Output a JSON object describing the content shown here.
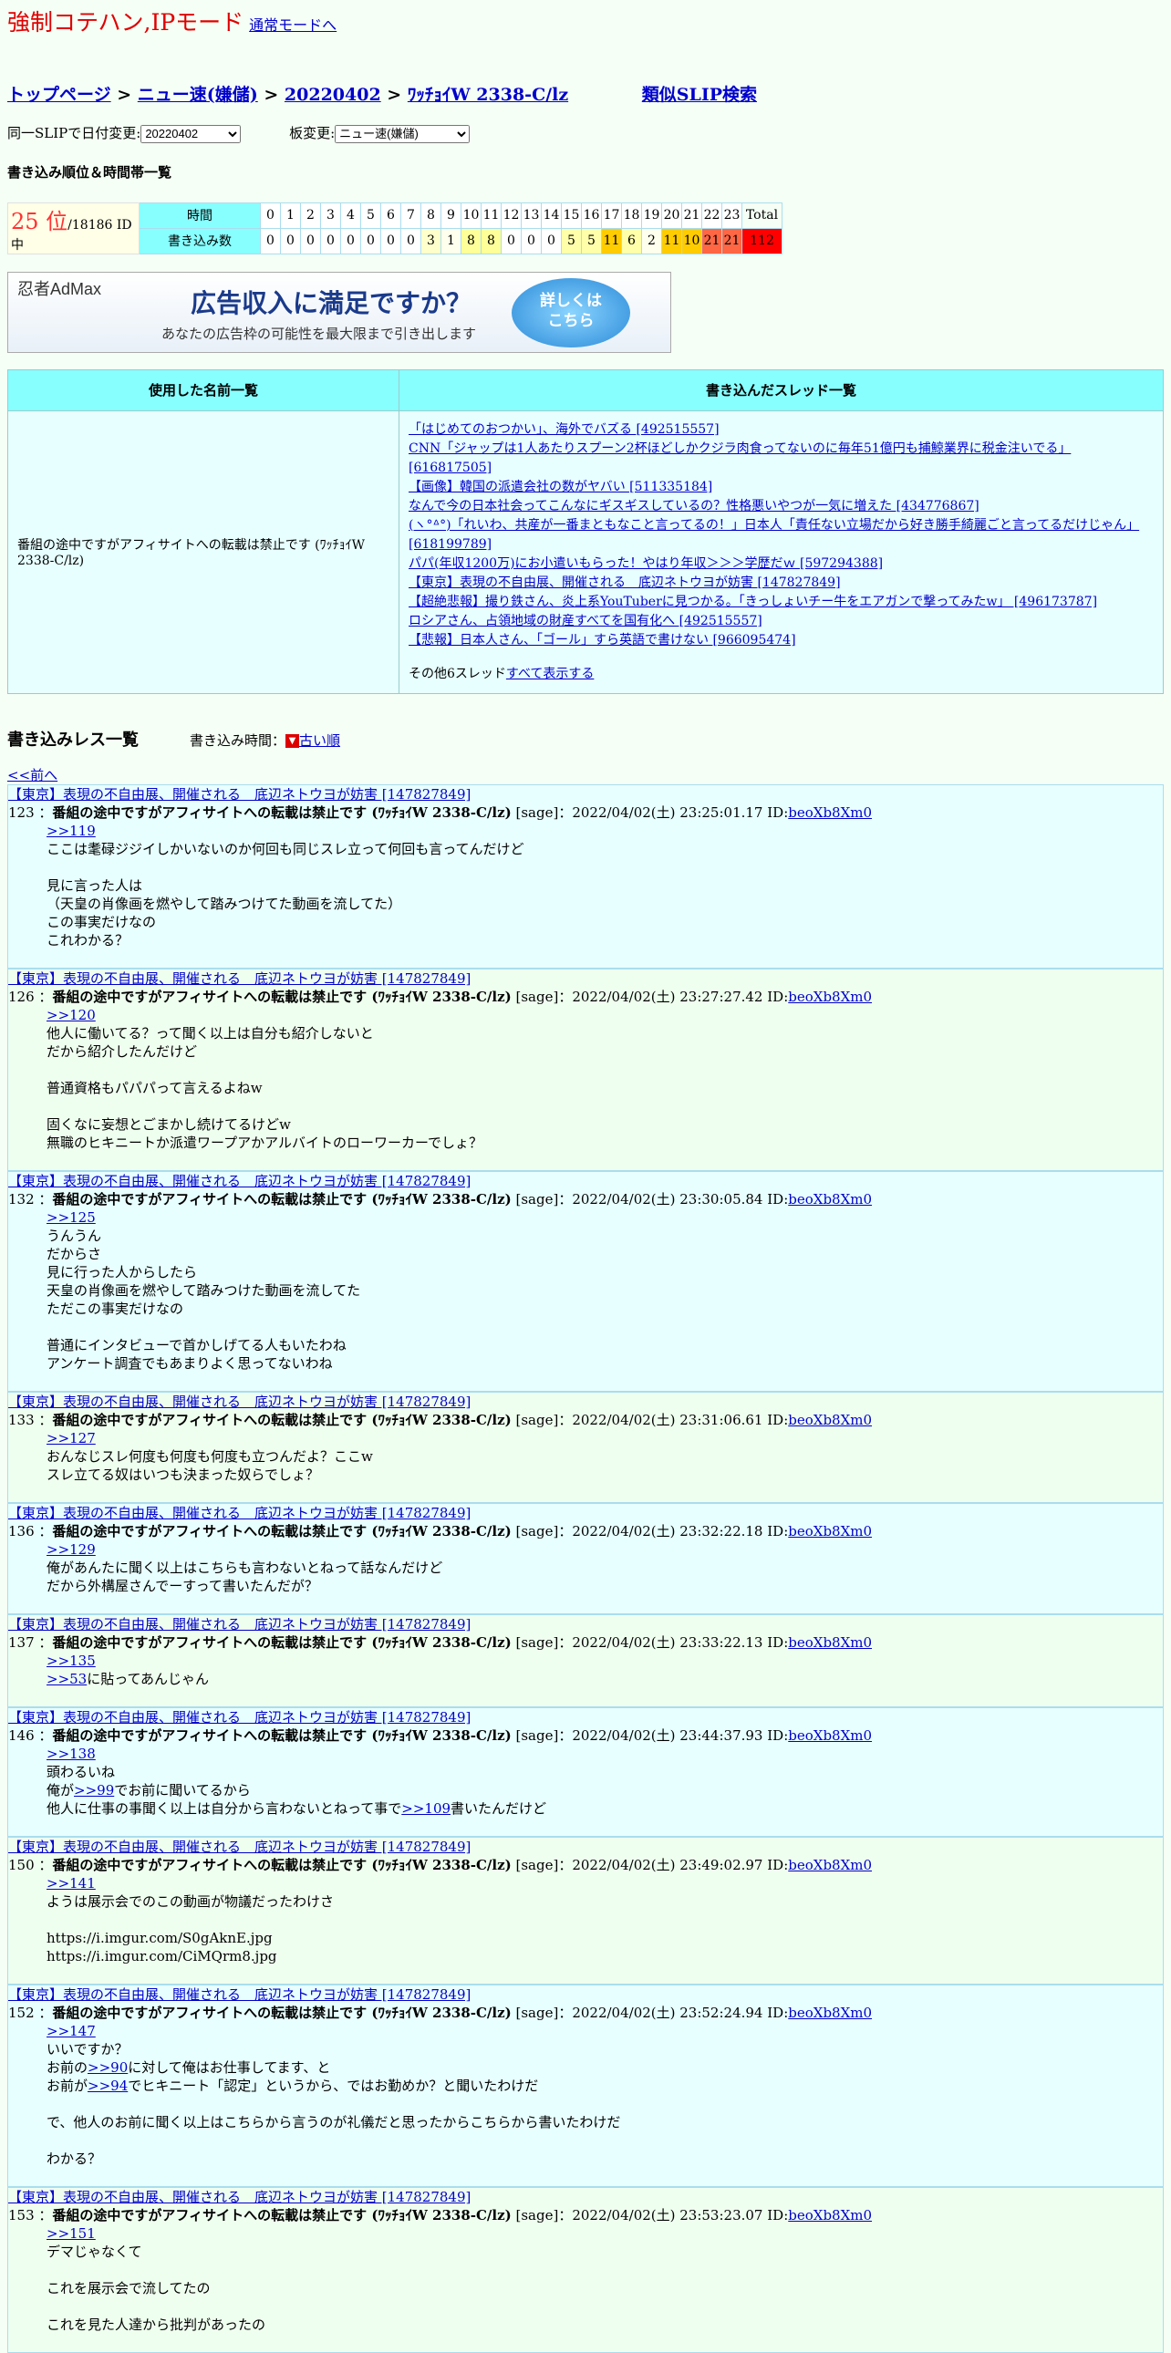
{
  "header": {
    "title": "強制コテハン,IPモード",
    "normal_link": "通常モードへ"
  },
  "breadcrumb": {
    "top": "トップページ",
    "board": "ニュー速(嫌儲)",
    "date": "20220402",
    "slip": "ﾜｯﾁｮｲW 2338-C/lz",
    "similar": "類似SLIP検索"
  },
  "selectors": {
    "date_label": "同一SLIPで日付変更:",
    "date_value": "20220402",
    "board_label": "板変更:",
    "board_value": "ニュー速(嫌儲)"
  },
  "rank_section": {
    "heading": "書き込み順位＆時間帯一覧",
    "rank": "25 位",
    "rank_suffix": "/18186 ID中",
    "time_label": "時間",
    "count_label": "書き込み数",
    "hours": [
      "0",
      "1",
      "2",
      "3",
      "4",
      "5",
      "6",
      "7",
      "8",
      "9",
      "10",
      "11",
      "12",
      "13",
      "14",
      "15",
      "16",
      "17",
      "18",
      "19",
      "20",
      "21",
      "22",
      "23",
      "Total"
    ],
    "counts": [
      "0",
      "0",
      "0",
      "0",
      "0",
      "0",
      "0",
      "0",
      "3",
      "1",
      "8",
      "8",
      "0",
      "0",
      "0",
      "5",
      "5",
      "11",
      "6",
      "2",
      "11",
      "10",
      "21",
      "21",
      "112"
    ],
    "count_colors": [
      "#ffffff",
      "#ffffff",
      "#ffffff",
      "#ffffff",
      "#ffffff",
      "#ffffff",
      "#ffffff",
      "#ffffff",
      "#ffffcc",
      "#ffffee",
      "#ffff99",
      "#ffff99",
      "#ffffff",
      "#ffffff",
      "#ffffff",
      "#ffffaa",
      "#ffffaa",
      "#ffcc00",
      "#ffffaa",
      "#ffffee",
      "#ffcc00",
      "#ffcc00",
      "#ff6644",
      "#ff6644",
      "#ff0000"
    ]
  },
  "ad": {
    "logo": "忍者AdMax",
    "headline": "広告収入に満足ですか？",
    "sub": "あなたの広告枠の可能性を最大限まで引き出します",
    "button_line1": "詳しくは",
    "button_line2": "こちら"
  },
  "names_table": {
    "col1": "使用した名前一覧",
    "col2": "書き込んだスレッド一覧",
    "name": "番組の途中ですがアフィサイトへの転載は禁止です (ﾜｯﾁｮｲW 2338-C/lz)",
    "threads": [
      "「はじめてのおつかい」、海外でバズる [492515557]",
      "CNN「ジャップは1人あたりスプーン2杯ほどしかクジラ肉食ってないのに毎年51億円も捕鯨業界に税金注いでる」 [616817505]",
      "【画像】韓国の派遣会社の数がヤバい [511335184]",
      "なんで今の日本社会ってこんなにギスギスしているの？性格悪いやつが一気に増えた [434776867]",
      "(ヽ°ᐞ°)「れいわ、共産が一番まともなこと言ってるの！」日本人「責任ない立場だから好き勝手綺麗ごと言ってるだけじゃん」 [618199789]",
      "パパ(年収1200万)にお小遣いもらった！やはり年収＞＞＞学歴だｗ [597294388]",
      "【東京】表現の不自由展、開催される　底辺ネトウヨが妨害 [147827849]",
      "【超絶悲報】撮り鉄さん、炎上系YouTuberに見つかる。「きっしょいチー牛をエアガンで撃ってみたw」 [496173787]",
      "ロシアさん、占領地域の財産すべてを国有化へ [492515557]",
      "【悲報】日本人さん、「ゴール」すら英語で書けない [966095474]"
    ],
    "more_text": "その他6スレッド",
    "more_link": "すべて表示する"
  },
  "responses": {
    "heading": "書き込みレス一覧",
    "order_label": "書き込み時間：",
    "order_link": "古い順",
    "prev_link": "<<前へ"
  },
  "posts": [
    {
      "thread": "【東京】表現の不自由展、開催される　底辺ネトウヨが妨害 [147827849]",
      "num": "123",
      "name": "番組の途中ですがアフィサイトへの転載は禁止です (ﾜｯﾁｮｲW 2338-C/lz)",
      "meta": "[sage]：2022/04/02(土) 23:25:01.17 ID:",
      "id": "beoXb8Xm0",
      "body": ">>119\nここは耄碌ジジイしかいないのか何回も同じスレ立って何回も言ってんだけど\n\n見に言った人は\n（天皇の肖像画を燃やして踏みつけてた動画を流してた）\nこの事実だけなの\nこれわかる？"
    },
    {
      "thread": "【東京】表現の不自由展、開催される　底辺ネトウヨが妨害 [147827849]",
      "num": "126",
      "name": "番組の途中ですがアフィサイトへの転載は禁止です (ﾜｯﾁｮｲW 2338-C/lz)",
      "meta": "[sage]：2022/04/02(土) 23:27:27.42 ID:",
      "id": "beoXb8Xm0",
      "body": ">>120\n他人に働いてる？って聞く以上は自分も紹介しないと\nだから紹介したんだけど\n\n普通資格もパパパって言えるよねw\n\n固くなに妄想とごまかし続けてるけどw\n無職のヒキニートか派遣ワープアかアルバイトのローワーカーでしょ？"
    },
    {
      "thread": "【東京】表現の不自由展、開催される　底辺ネトウヨが妨害 [147827849]",
      "num": "132",
      "name": "番組の途中ですがアフィサイトへの転載は禁止です (ﾜｯﾁｮｲW 2338-C/lz)",
      "meta": "[sage]：2022/04/02(土) 23:30:05.84 ID:",
      "id": "beoXb8Xm0",
      "body": ">>125\nうんうん\nだからさ\n見に行った人からしたら\n天皇の肖像画を燃やして踏みつけた動画を流してた\nただこの事実だけなの\n\n普通にインタビューで首かしげてる人もいたわね\nアンケート調査でもあまりよく思ってないわね"
    },
    {
      "thread": "【東京】表現の不自由展、開催される　底辺ネトウヨが妨害 [147827849]",
      "num": "133",
      "name": "番組の途中ですがアフィサイトへの転載は禁止です (ﾜｯﾁｮｲW 2338-C/lz)",
      "meta": "[sage]：2022/04/02(土) 23:31:06.61 ID:",
      "id": "beoXb8Xm0",
      "body": ">>127\nおんなじスレ何度も何度も何度も立つんだよ？ここw\nスレ立てる奴はいつも決まった奴らでしょ？"
    },
    {
      "thread": "【東京】表現の不自由展、開催される　底辺ネトウヨが妨害 [147827849]",
      "num": "136",
      "name": "番組の途中ですがアフィサイトへの転載は禁止です (ﾜｯﾁｮｲW 2338-C/lz)",
      "meta": "[sage]：2022/04/02(土) 23:32:22.18 ID:",
      "id": "beoXb8Xm0",
      "body": ">>129\n俺があんたに聞く以上はこちらも言わないとねって話なんだけど\nだから外構屋さんでーすって書いたんだが？"
    },
    {
      "thread": "【東京】表現の不自由展、開催される　底辺ネトウヨが妨害 [147827849]",
      "num": "137",
      "name": "番組の途中ですがアフィサイトへの転載は禁止です (ﾜｯﾁｮｲW 2338-C/lz)",
      "meta": "[sage]：2022/04/02(土) 23:33:22.13 ID:",
      "id": "beoXb8Xm0",
      "body": ">>135\n>>53に貼ってあんじゃん"
    },
    {
      "thread": "【東京】表現の不自由展、開催される　底辺ネトウヨが妨害 [147827849]",
      "num": "146",
      "name": "番組の途中ですがアフィサイトへの転載は禁止です (ﾜｯﾁｮｲW 2338-C/lz)",
      "meta": "[sage]：2022/04/02(土) 23:44:37.93 ID:",
      "id": "beoXb8Xm0",
      "body": ">>138\n頭わるいね\n俺が>>99でお前に聞いてるから\n他人に仕事の事聞く以上は自分から言わないとねって事で>>109書いたんだけど"
    },
    {
      "thread": "【東京】表現の不自由展、開催される　底辺ネトウヨが妨害 [147827849]",
      "num": "150",
      "name": "番組の途中ですがアフィサイトへの転載は禁止です (ﾜｯﾁｮｲW 2338-C/lz)",
      "meta": "[sage]：2022/04/02(土) 23:49:02.97 ID:",
      "id": "beoXb8Xm0",
      "body": ">>141\nようは展示会でのこの動画が物議だったわけさ\n\nhttps://i.imgur.com/S0gAknE.jpg\nhttps://i.imgur.com/CiMQrm8.jpg"
    },
    {
      "thread": "【東京】表現の不自由展、開催される　底辺ネトウヨが妨害 [147827849]",
      "num": "152",
      "name": "番組の途中ですがアフィサイトへの転載は禁止です (ﾜｯﾁｮｲW 2338-C/lz)",
      "meta": "[sage]：2022/04/02(土) 23:52:24.94 ID:",
      "id": "beoXb8Xm0",
      "body": ">>147\nいいですか？\nお前の>>90に対して俺はお仕事してます、と\nお前が>>94でヒキニート「認定」というから、ではお勤めか？と聞いたわけだ\n\nで、他人のお前に聞く以上はこちらから言うのが礼儀だと思ったからこちらから書いたわけだ\n\nわかる？"
    },
    {
      "thread": "【東京】表現の不自由展、開催される　底辺ネトウヨが妨害 [147827849]",
      "num": "153",
      "name": "番組の途中ですがアフィサイトへの転載は禁止です (ﾜｯﾁｮｲW 2338-C/lz)",
      "meta": "[sage]：2022/04/02(土) 23:53:23.07 ID:",
      "id": "beoXb8Xm0",
      "body": ">>151\nデマじゃなくて\n\nこれを展示会で流してたの\n\nこれを見た人達から批判があったの"
    }
  ]
}
